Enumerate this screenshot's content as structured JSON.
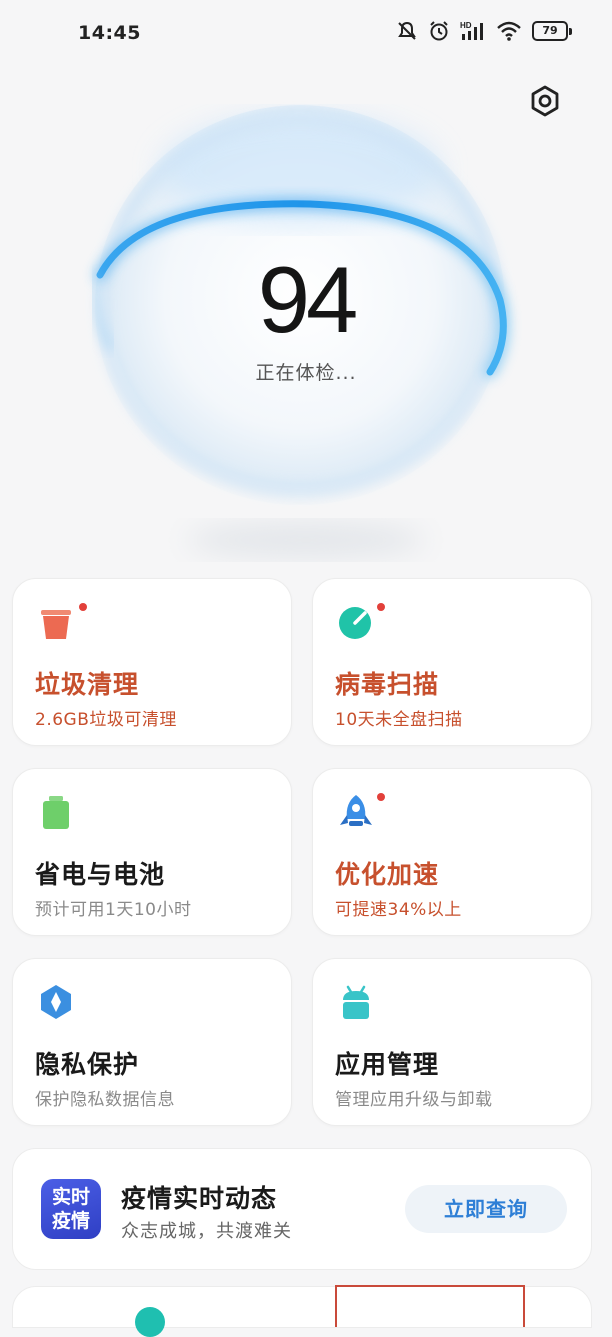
{
  "status_bar": {
    "time": "14:45",
    "network": "HD",
    "battery": "79",
    "icons": [
      "mute-icon",
      "alarm-icon",
      "signal-icon",
      "wifi-icon",
      "battery-icon"
    ]
  },
  "settings": {
    "icon": "gear-hexagon-icon"
  },
  "hero": {
    "score": "94",
    "status": "正在体检..."
  },
  "cards": [
    {
      "id": "junk",
      "title": "垃圾清理",
      "subtitle": "2.6GB垃圾可清理",
      "icon": "trash-can-icon",
      "icon_color": "#ec6a52",
      "badge": true,
      "style": "warn"
    },
    {
      "id": "virus",
      "title": "病毒扫描",
      "subtitle": "10天未全盘扫描",
      "icon": "radar-icon",
      "icon_color": "#20c3a8",
      "badge": true,
      "style": "warn"
    },
    {
      "id": "battery",
      "title": "省电与电池",
      "subtitle": "预计可用1天10小时",
      "icon": "battery-icon",
      "icon_color": "#6ecf6a",
      "badge": false,
      "style": "normal"
    },
    {
      "id": "boost",
      "title": "优化加速",
      "subtitle": "可提速34%以上",
      "icon": "rocket-icon",
      "icon_color": "#3a8ee6",
      "badge": true,
      "style": "warn"
    },
    {
      "id": "privacy",
      "title": "隐私保护",
      "subtitle": "保护隐私数据信息",
      "icon": "shield-diamond-icon",
      "icon_color": "#3b8fe0",
      "badge": false,
      "style": "normal"
    },
    {
      "id": "apps",
      "title": "应用管理",
      "subtitle": "管理应用升级与卸载",
      "icon": "android-icon",
      "icon_color": "#39c4c8",
      "badge": false,
      "style": "normal"
    }
  ],
  "banner": {
    "logo_line1": "实时",
    "logo_line2": "疫情",
    "title": "疫情实时动态",
    "subtitle": "众志成城，共渡难关",
    "button": "立即查询"
  },
  "colors": {
    "warn_text": "#c7502d",
    "accent_blue": "#2e7fd6",
    "badge_red": "#e2403a"
  }
}
